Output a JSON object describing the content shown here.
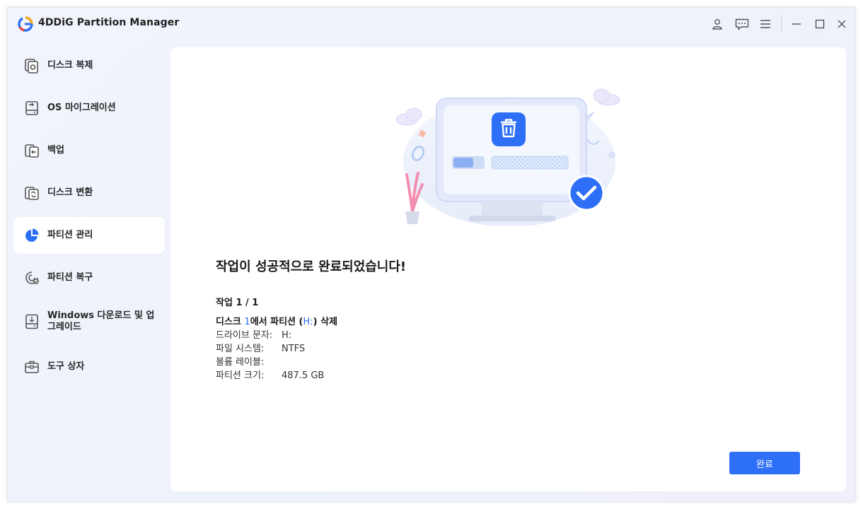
{
  "app": {
    "title": "4DDiG Partition Manager"
  },
  "titlebar": {
    "icons": [
      "user-icon",
      "feedback-icon",
      "menu-icon",
      "minimize-icon",
      "maximize-icon",
      "close-icon"
    ]
  },
  "sidebar": {
    "items": [
      {
        "label": "디스크 복제",
        "icon": "disk-clone-icon"
      },
      {
        "label": "OS 마이그레이션",
        "icon": "os-migration-icon"
      },
      {
        "label": "백업",
        "icon": "backup-icon"
      },
      {
        "label": "디스크 변환",
        "icon": "disk-convert-icon"
      },
      {
        "label": "파티션 관리",
        "icon": "pie-chart-icon",
        "active": true
      },
      {
        "label": "파티션 복구",
        "icon": "partition-recovery-icon"
      },
      {
        "label": "Windows 다운로드 및 업그레이드",
        "icon": "windows-download-icon"
      },
      {
        "label": "도구 상자",
        "icon": "toolbox-icon"
      }
    ]
  },
  "main": {
    "success_title": "작업이 성공적으로 완료되었습니다!",
    "task_count": "작업 1 / 1",
    "operation": {
      "prefix": "디스크 ",
      "disk_no": "1",
      "middle": "에서 파티션 (",
      "drive": "H:",
      "suffix": ") 삭제"
    },
    "details": [
      {
        "key": "드라이브 문자:",
        "value": "H:"
      },
      {
        "key": "파일 시스템:",
        "value": "NTFS"
      },
      {
        "key": "볼륨 레이블:",
        "value": ""
      },
      {
        "key": "파티션 크기:",
        "value": "487.5 GB"
      }
    ],
    "done_button": "완료"
  },
  "colors": {
    "accent": "#2d6ff7",
    "highlight": "#2f6ff0"
  }
}
